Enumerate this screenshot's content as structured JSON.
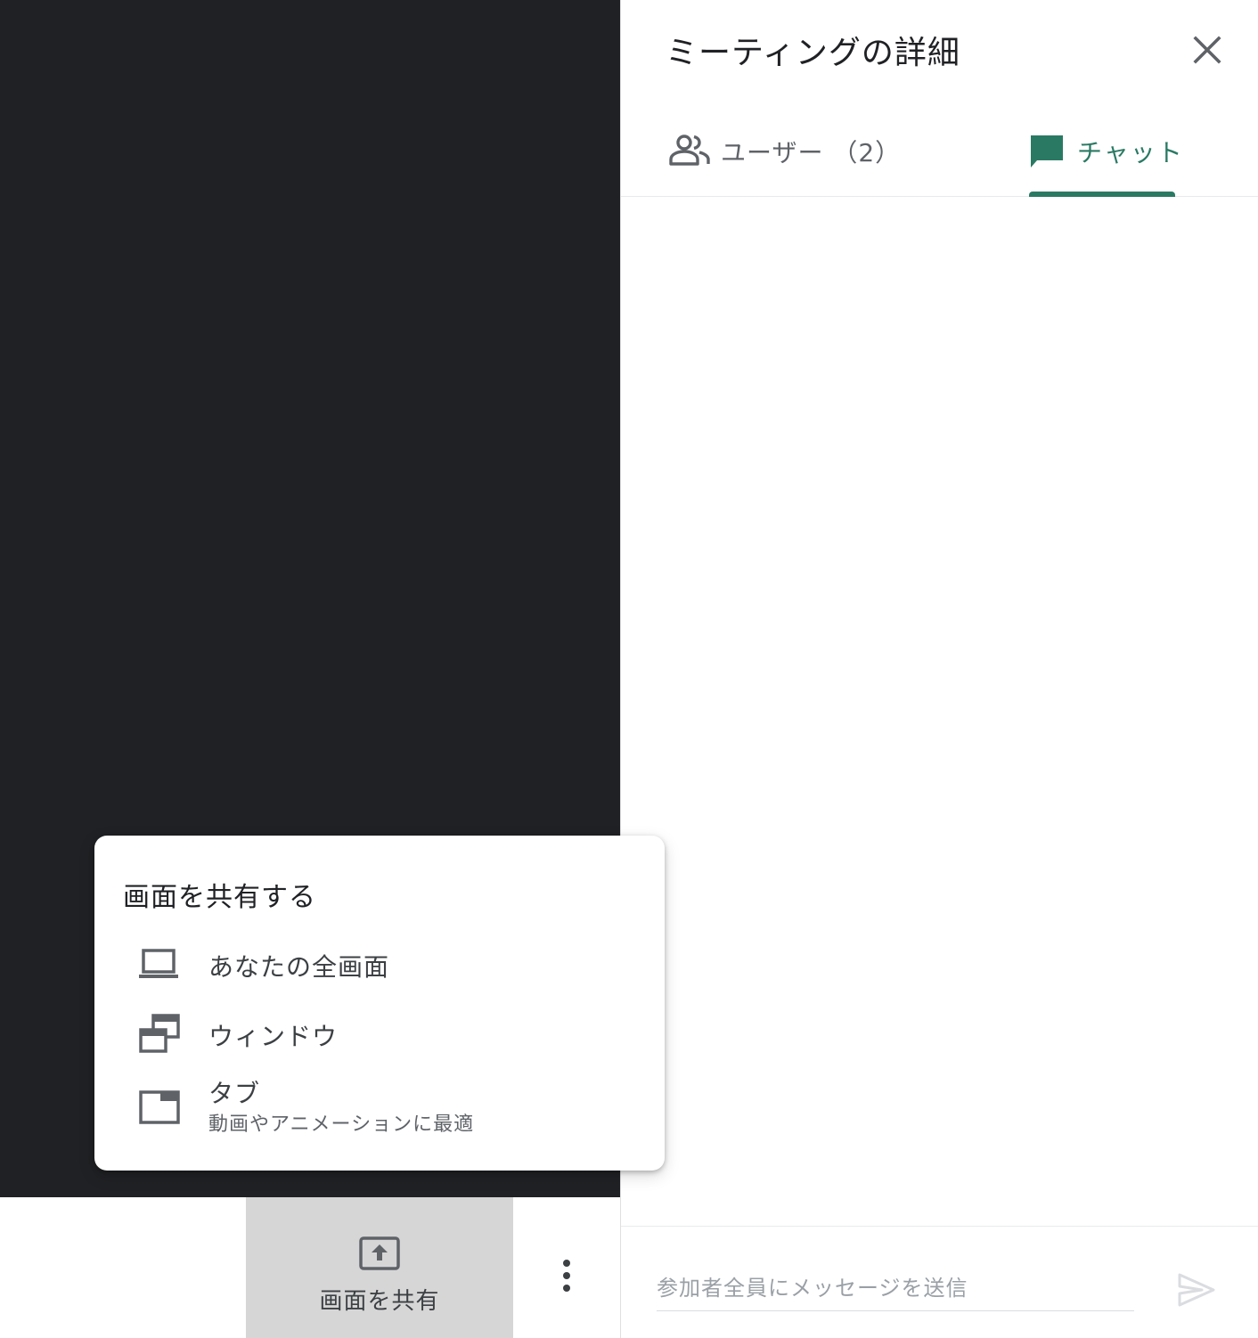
{
  "video_area": {},
  "bottom_bar": {
    "share_button_label": "画面を共有",
    "share_icon": "present-to-all-icon",
    "more_icon": "more-vert-icon"
  },
  "side_panel": {
    "title": "ミーティングの詳細",
    "close_icon": "close-icon",
    "tabs": [
      {
        "label": "ユーザー （2）",
        "icon": "people-icon",
        "selected": false
      },
      {
        "label": "チャット",
        "icon": "chat-icon",
        "selected": true
      }
    ],
    "accent_color": "#2a7a63",
    "message_placeholder": "参加者全員にメッセージを送信",
    "send_icon": "send-icon"
  },
  "share_popup": {
    "title": "画面を共有する",
    "options": [
      {
        "label": "あなたの全画面",
        "icon": "laptop-icon"
      },
      {
        "label": "ウィンドウ",
        "icon": "window-icon"
      },
      {
        "label": "タブ",
        "sublabel": "動画やアニメーションに最適",
        "icon": "tab-icon"
      }
    ]
  }
}
